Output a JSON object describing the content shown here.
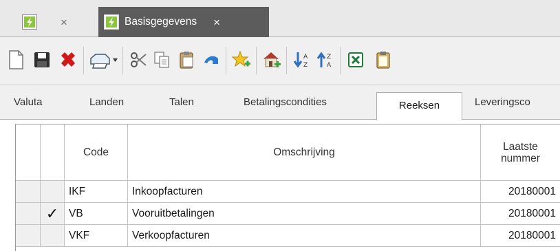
{
  "doc_tabs": [
    {
      "title": "",
      "close": "×"
    },
    {
      "title": "Basisgegevens",
      "close": "×"
    }
  ],
  "toolbar": {
    "buttons": [
      "new-icon",
      "save-icon",
      "delete-icon",
      "print-dropdown-icon",
      "cut-icon",
      "copy-icon",
      "paste-icon",
      "undo-icon",
      "favorite-add-icon",
      "home-add-icon",
      "sort-ascending-icon",
      "sort-descending-icon",
      "excel-export-icon",
      "clipboard-icon"
    ]
  },
  "subtabs": [
    "Valuta",
    "Landen",
    "Talen",
    "Betalingscondities",
    "Reeksen",
    "Leveringsco"
  ],
  "selected_subtab": "Reeksen",
  "grid": {
    "headers": {
      "code": "Code",
      "omschrijving": "Omschrijving",
      "laatste_line1": "Laatste",
      "laatste_line2": "nummer"
    },
    "rows": [
      {
        "check": "",
        "code": "IKF",
        "omschrijving": "Inkoopfacturen",
        "laatste_nummer": "20180001"
      },
      {
        "check": "✓",
        "code": "VB",
        "omschrijving": "Vooruitbetalingen",
        "laatste_nummer": "20180001"
      },
      {
        "check": "",
        "code": "VKF",
        "omschrijving": "Verkoopfacturen",
        "laatste_nummer": "20180001"
      }
    ]
  },
  "colors": {
    "active_tab": "#5c5c5c",
    "accent_green": "#7fbf3f",
    "toolbar_bg": "#f0f0f0",
    "delete_red": "#d01818"
  }
}
